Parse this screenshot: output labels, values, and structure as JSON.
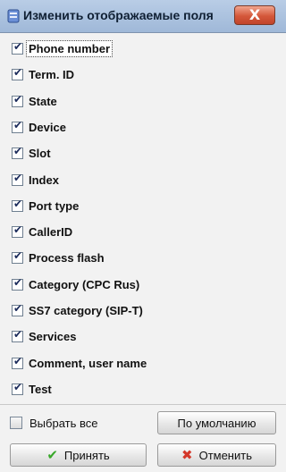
{
  "window": {
    "title": "Изменить отображаемые поля",
    "close_label": "X"
  },
  "fields": [
    {
      "label": "Phone number",
      "checked": true
    },
    {
      "label": "Term. ID",
      "checked": true
    },
    {
      "label": "State",
      "checked": true
    },
    {
      "label": "Device",
      "checked": true
    },
    {
      "label": "Slot",
      "checked": true
    },
    {
      "label": "Index",
      "checked": true
    },
    {
      "label": "Port type",
      "checked": true
    },
    {
      "label": "CallerID",
      "checked": true
    },
    {
      "label": "Process flash",
      "checked": true
    },
    {
      "label": "Category (CPC Rus)",
      "checked": true
    },
    {
      "label": "SS7 category (SIP-T)",
      "checked": true
    },
    {
      "label": "Services",
      "checked": true
    },
    {
      "label": "Comment, user name",
      "checked": true
    },
    {
      "label": "Test",
      "checked": true
    }
  ],
  "footer": {
    "select_all_label": "Выбрать все",
    "select_all_checked": false,
    "default_label": "По умолчанию",
    "ok_label": "Принять",
    "cancel_label": "Отменить"
  },
  "icons": {
    "app": "app-window-icon",
    "ok": "checkmark-icon",
    "cancel": "cross-icon"
  },
  "colors": {
    "ok_icon": "#38a82a",
    "cancel_icon": "#d4382a"
  }
}
